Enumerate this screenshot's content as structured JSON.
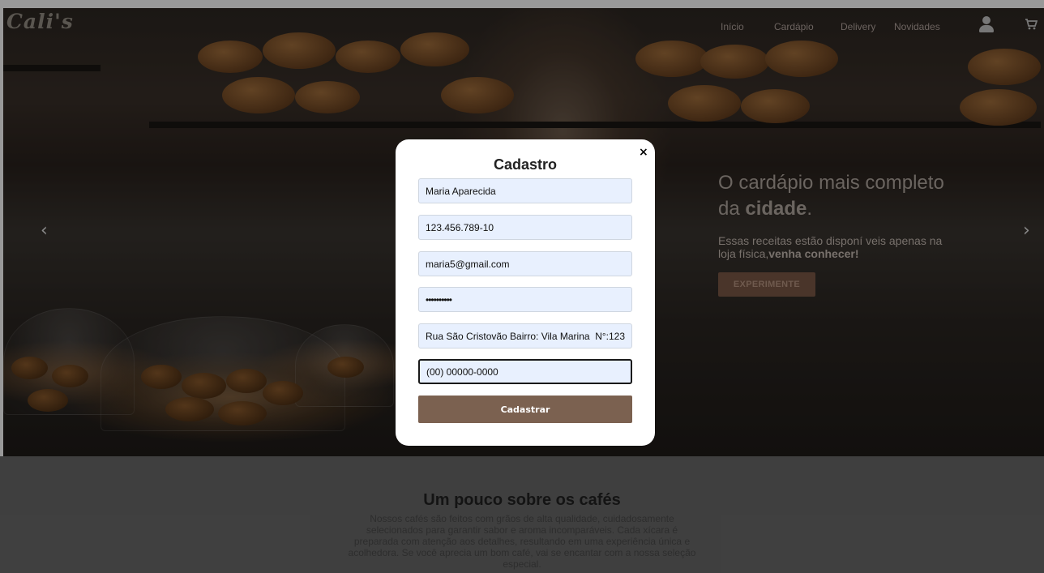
{
  "header": {
    "logo": "Cali's",
    "nav": [
      "Início",
      "Cardápio",
      "Delivery",
      "Novidades"
    ],
    "user_icon": "user-icon",
    "cart_icon": "cart-icon"
  },
  "carousel": {
    "prev_icon": "‹",
    "next_icon": "›",
    "promo": {
      "title_part1": "O cardápio mais completo da ",
      "title_bold": "cidade",
      "title_end": ".",
      "text_part1": "Essas receitas estão disponí veis apenas na loja física,",
      "text_bold": "venha conhecer!",
      "button": "EXPERIMENTE"
    }
  },
  "about": {
    "title": "Um pouco sobre os cafés",
    "text": "Nossos cafés são feitos com grãos de alta qualidade, cuidadosamente selecionados para garantir sabor e aroma incomparáveis. Cada xícara é preparada com atenção aos detalhes, resultando em uma experiência única e acolhedora. Se você aprecia um bom café, vai se encantar com a nossa seleção especial."
  },
  "modal": {
    "close": "×",
    "title": "Cadastro",
    "fields": {
      "name": "Maria Aparecida",
      "cpf": "123.456.789-10",
      "email": "maria5@gmail.com",
      "password": "••••••••••",
      "address": "Rua São Cristovão Bairro: Vila Marina  N°:123",
      "phone": "(00) 00000-0000"
    },
    "submit": "Cadastrar"
  },
  "colors": {
    "accent_brown": "#7b6150",
    "field_bg": "#e8f0fe"
  }
}
